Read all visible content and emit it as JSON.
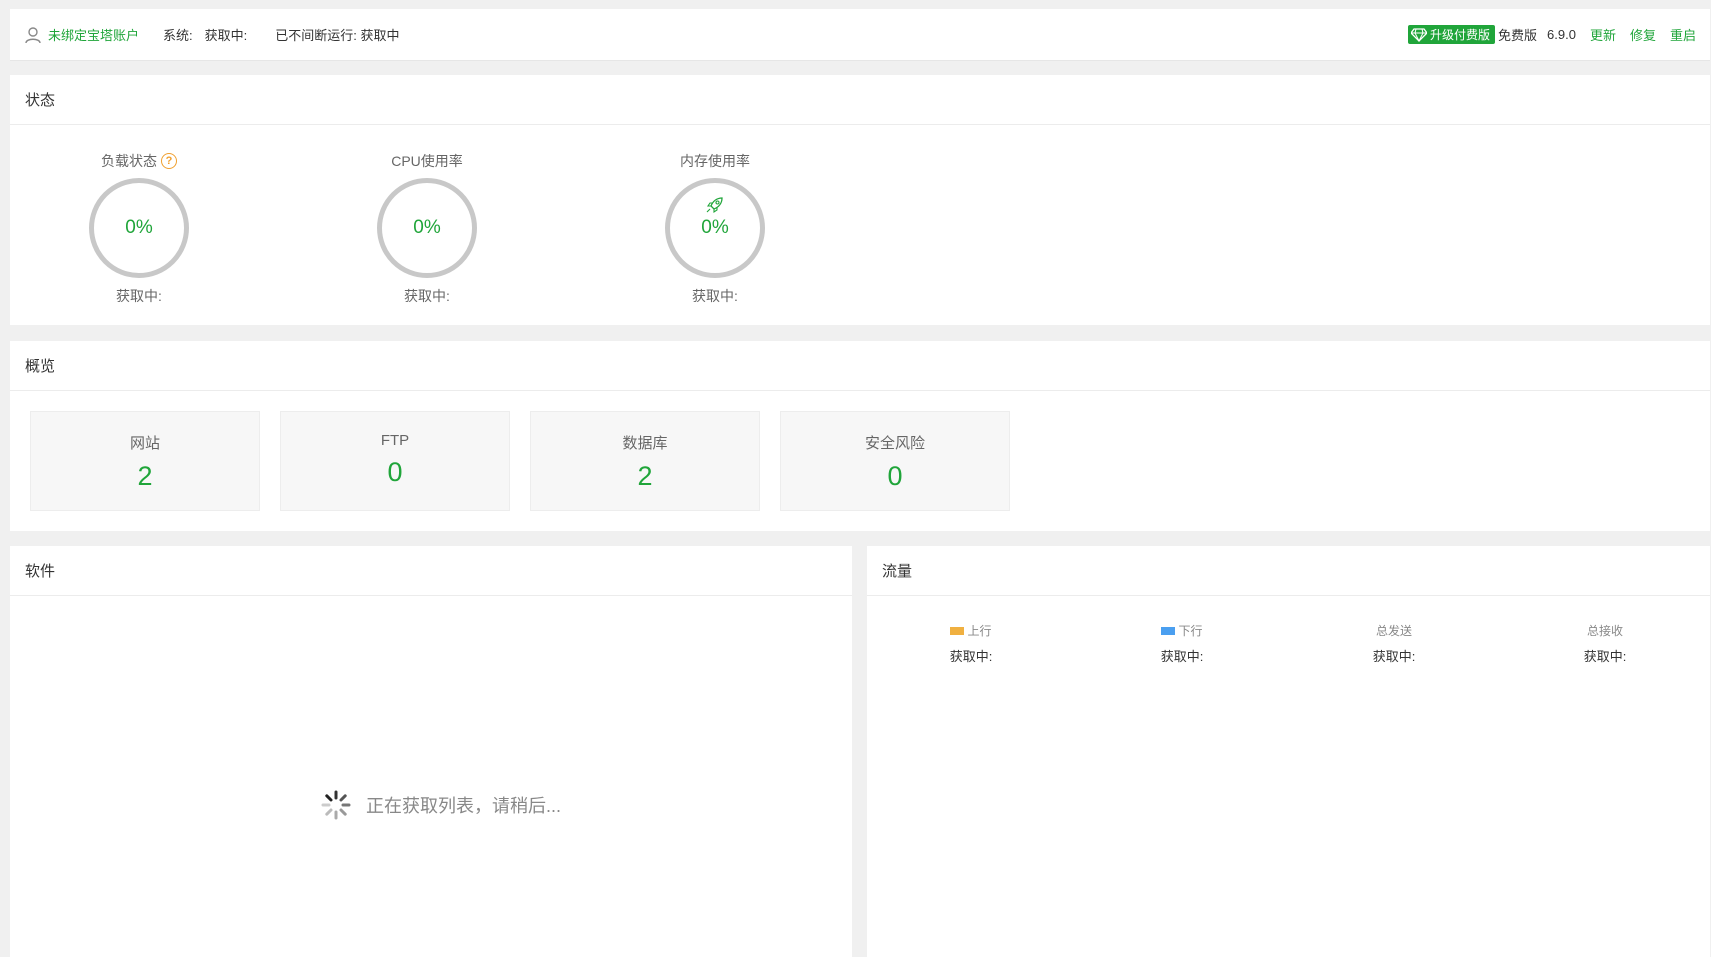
{
  "topbar": {
    "bind_account": "未绑定宝塔账户",
    "system_label": "系统:",
    "system_value": "获取中:",
    "uptime": "已不间断运行: 获取中",
    "upgrade": "升级付费版",
    "edition": "免费版",
    "version": "6.9.0",
    "update": "更新",
    "repair": "修复",
    "restart": "重启"
  },
  "status": {
    "title": "状态",
    "gauges": [
      {
        "label": "负载状态",
        "value": "0%",
        "sub": "获取中:"
      },
      {
        "label": "CPU使用率",
        "value": "0%",
        "sub": "获取中:"
      },
      {
        "label": "内存使用率",
        "value": "0%",
        "sub": "获取中:"
      }
    ]
  },
  "overview": {
    "title": "概览",
    "cards": [
      {
        "label": "网站",
        "value": "2"
      },
      {
        "label": "FTP",
        "value": "0"
      },
      {
        "label": "数据库",
        "value": "2"
      },
      {
        "label": "安全风险",
        "value": "0"
      }
    ]
  },
  "software": {
    "title": "软件",
    "loading": "正在获取列表，请稍后..."
  },
  "traffic": {
    "title": "流量",
    "columns": [
      {
        "label": "上行",
        "value": "获取中:",
        "color": "#f0b040"
      },
      {
        "label": "下行",
        "value": "获取中:",
        "color": "#4a9ff0"
      },
      {
        "label": "总发送",
        "value": "获取中:"
      },
      {
        "label": "总接收",
        "value": "获取中:"
      }
    ]
  },
  "colors": {
    "accent": "#20a53a",
    "ring": "#c8c8c8"
  }
}
